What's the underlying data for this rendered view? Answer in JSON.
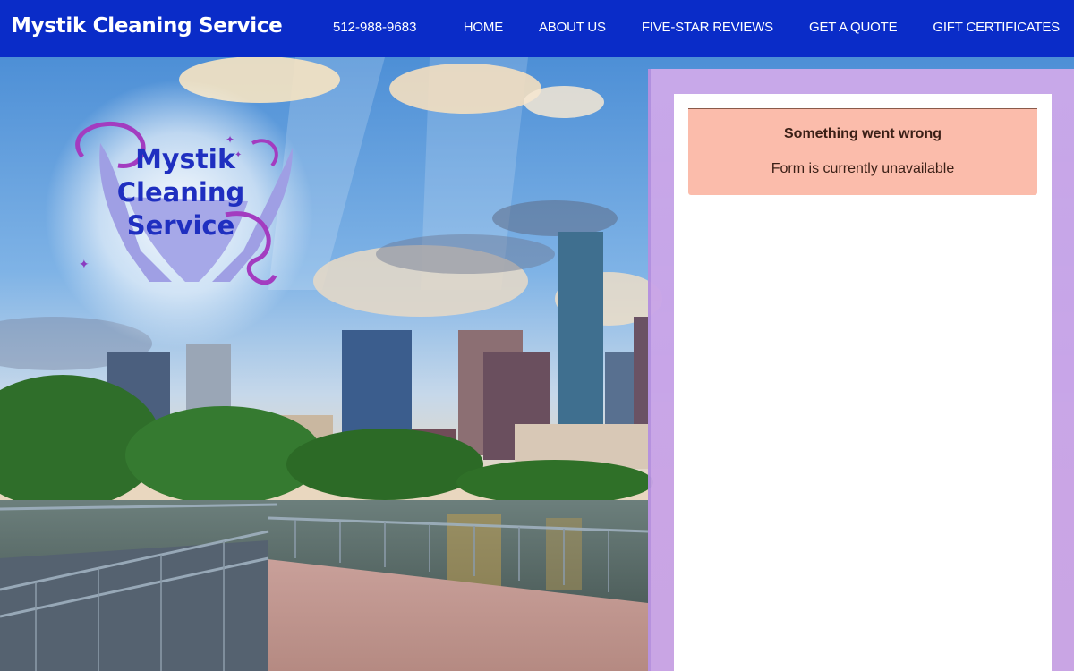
{
  "header": {
    "brand": "Mystik Cleaning Service",
    "phone": "512-988-9683",
    "nav": [
      "HOME",
      "ABOUT US",
      "FIVE-STAR REVIEWS",
      "GET A QUOTE",
      "GIFT CERTIFICATES"
    ]
  },
  "hero": {
    "logo_text": [
      "Mystik",
      "Cleaning",
      "Service"
    ],
    "background": "city-skyline-boardwalk-photo"
  },
  "form": {
    "alert_title": "Something went wrong",
    "alert_message": "Form is currently unavailable"
  },
  "colors": {
    "nav_bg": "#0a2cc8",
    "frame": "#cda9ea",
    "alert_bg": "#fbbcab",
    "logo_text": "#1f2fc0",
    "logo_hands": "#9f9fe4",
    "logo_swirl": "#a33cc0"
  }
}
